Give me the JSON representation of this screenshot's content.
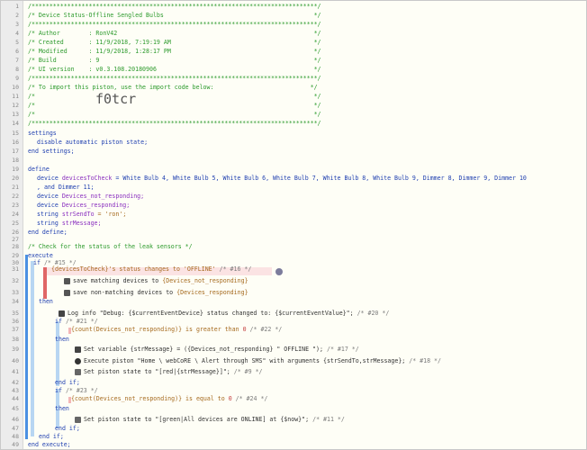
{
  "code": {
    "header_border": "/********************************************************************************/",
    "title": "/* Device Status-Offline Sengled Bulbs                                          */",
    "border2": "/********************************************************************************/",
    "author": "/* Author        : RonV42                                                       */",
    "created": "/* Created       : 11/9/2018, 7:19:19 AM                                        */",
    "modified": "/* Modified      : 11/9/2018, 1:28:17 PM                                        */",
    "build": "/* Build         : 9                                                            */",
    "ui_version": "/* UI version    : v0.3.108.20180906                                            */",
    "border3": "/********************************************************************************/",
    "import_line": "/* To import this piston, use the import code below:                           */",
    "blank1": "/*                                                                              */",
    "import_code": "f0tcr",
    "blank2": "/*                                                                              */",
    "border4": "/********************************************************************************/",
    "settings": "settings",
    "disable_state": "disable automatic piston state;",
    "end_settings": "end settings;",
    "define": "define",
    "device_kw": "device",
    "devices_to_check": "devicesToCheck",
    "devices_list": "= White Bulb 4, White Bulb 5, White Bulb 6, White Bulb 7, White Bulb 8, White Bulb 9, Dimmer 8, Dimmer 9, Dimmer 10",
    "devices_list_cont": ", and Dimmer 11;",
    "not_responding": "Devices_not_responding;",
    "responding": "Devices_responding;",
    "string_kw": "string",
    "str_send_to": "strSendTo",
    "str_send_to_val": "= 'ron';",
    "str_message": "strMessage;",
    "end_define": "end define;",
    "comment_leak": "/* Check for the status of the leak sensors */",
    "execute": "execute",
    "if_kw": "if",
    "if15": "/* #15 */",
    "cond_status": "{devicesToCheck}'s status changes to 'OFFLINE'",
    "cond_status_id": "/* #16 */",
    "save_matching": "save matching devices to",
    "save_matching_var": "{Devices_not_responding}",
    "save_nonmatching": "save non-matching devices to",
    "save_nonmatching_var": "{Devices_responding}",
    "then": "then",
    "log_info": "Log info \"Debug: {$currentEventDevice} status changed to: {$currentEventValue}\";",
    "log_id": "/* #20 */",
    "if21": "/* #21 */",
    "count_gt": "{count(Devices_not_responding)} is greater than",
    "count_gt_val": "0",
    "count_gt_id": "/* #22 */",
    "set_var": "Set variable {strMessage} = ({Devices_not_responding} \" OFFLINE \");",
    "set_var_id": "/* #17 */",
    "exec_piston": "Execute piston \"Home \\ webCoRE \\ Alert through SMS\" with arguments {strSendTo,strMessage};",
    "exec_piston_id": "/* #18 */",
    "set_state1": "Set piston state to \"[red|{strMessage}]\";",
    "set_state1_id": "/* #9 */",
    "end_if": "end if;",
    "if23": "/* #23 */",
    "count_eq": "{count(Devices_not_responding)} is equal to",
    "count_eq_val": "0",
    "count_eq_id": "/* #24 */",
    "set_state2": "Set piston state to \"[green|All devices are ONLINE] at {$now}\";",
    "set_state2_id": "/* #11 */",
    "end_execute": "end execute;"
  },
  "line_numbers": [
    "1",
    "2",
    "3",
    "4",
    "5",
    "6",
    "7",
    "8",
    "9",
    "10",
    "11",
    "12",
    "13",
    "14",
    "15",
    "16",
    "17",
    "18",
    "19",
    "20",
    "21",
    "22",
    "23",
    "24",
    "25",
    "26",
    "27",
    "28",
    "29",
    "30",
    "31",
    "32",
    "33",
    "34",
    "35",
    "36",
    "37",
    "38",
    "39",
    "40",
    "41",
    "42",
    "43",
    "44",
    "45",
    "46",
    "47",
    "48",
    "49",
    "50"
  ],
  "colors": {
    "comment": "#2c9a2c",
    "keyword": "#1f3fb0",
    "variable": "#8a2fbf",
    "value": "#a66a1e",
    "number": "#c43b3b",
    "bar_blue": "#4a90e2",
    "bar_light": "#b8d6f2",
    "bar_red": "#e06666",
    "bar_pink": "#f4b6b6"
  },
  "icons": [
    "x-icon",
    "debug-icon",
    "set-variable-icon",
    "execute-icon",
    "state-icon",
    "gear-icon"
  ]
}
